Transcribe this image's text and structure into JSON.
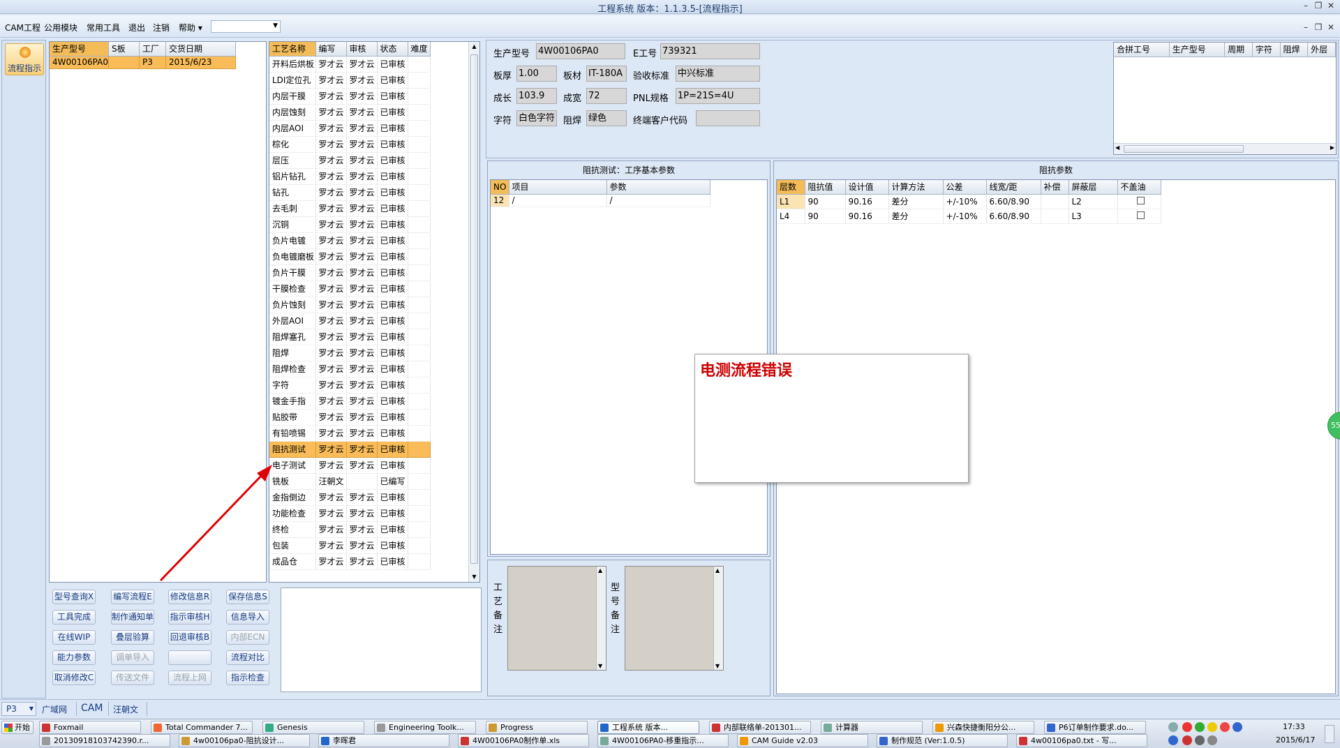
{
  "window": {
    "title": "工程系统 版本：1.1.3.5-[流程指示]"
  },
  "menu": {
    "items": [
      "CAM工程",
      "公用模块",
      "常用工具",
      "退出",
      "注销",
      "帮助 ▾"
    ]
  },
  "side_nav": {
    "label": "流程指示",
    "badge": "55"
  },
  "orders": {
    "columns": [
      "生产型号",
      "S板",
      "工厂",
      "交货日期"
    ],
    "rows": [
      [
        "4W00106PA0",
        "",
        "P3",
        "2015/6/23"
      ]
    ]
  },
  "process": {
    "columns": [
      "工艺名称",
      "编写",
      "审核",
      "状态",
      "难度"
    ],
    "rows": [
      [
        "开料后烘板",
        "罗才云",
        "罗才云",
        "已审核"
      ],
      [
        "LDI定位孔",
        "罗才云",
        "罗才云",
        "已审核"
      ],
      [
        "内层干膜",
        "罗才云",
        "罗才云",
        "已审核"
      ],
      [
        "内层蚀刻",
        "罗才云",
        "罗才云",
        "已审核"
      ],
      [
        "内层AOI",
        "罗才云",
        "罗才云",
        "已审核"
      ],
      [
        "棕化",
        "罗才云",
        "罗才云",
        "已审核"
      ],
      [
        "层压",
        "罗才云",
        "罗才云",
        "已审核"
      ],
      [
        "铝片钻孔",
        "罗才云",
        "罗才云",
        "已审核"
      ],
      [
        "钻孔",
        "罗才云",
        "罗才云",
        "已审核"
      ],
      [
        "去毛刺",
        "罗才云",
        "罗才云",
        "已审核"
      ],
      [
        "沉铜",
        "罗才云",
        "罗才云",
        "已审核"
      ],
      [
        "负片电镀",
        "罗才云",
        "罗才云",
        "已审核"
      ],
      [
        "负电镀磨板",
        "罗才云",
        "罗才云",
        "已审核"
      ],
      [
        "负片干膜",
        "罗才云",
        "罗才云",
        "已审核"
      ],
      [
        "干膜检查",
        "罗才云",
        "罗才云",
        "已审核"
      ],
      [
        "负片蚀刻",
        "罗才云",
        "罗才云",
        "已审核"
      ],
      [
        "外层AOI",
        "罗才云",
        "罗才云",
        "已审核"
      ],
      [
        "阻焊塞孔",
        "罗才云",
        "罗才云",
        "已审核"
      ],
      [
        "阻焊",
        "罗才云",
        "罗才云",
        "已审核"
      ],
      [
        "阻焊检查",
        "罗才云",
        "罗才云",
        "已审核"
      ],
      [
        "字符",
        "罗才云",
        "罗才云",
        "已审核"
      ],
      [
        "镀金手指",
        "罗才云",
        "罗才云",
        "已审核"
      ],
      [
        "贴胶带",
        "罗才云",
        "罗才云",
        "已审核"
      ],
      [
        "有铅喷锡",
        "罗才云",
        "罗才云",
        "已审核"
      ],
      [
        "阻抗测试",
        "罗才云",
        "罗才云",
        "已审核"
      ],
      [
        "电子测试",
        "罗才云",
        "罗才云",
        "已审核"
      ],
      [
        "铣板",
        "汪朝文",
        "",
        "已编写"
      ],
      [
        "金指倒边",
        "罗才云",
        "罗才云",
        "已审核"
      ],
      [
        "功能检查",
        "罗才云",
        "罗才云",
        "已审核"
      ],
      [
        "终检",
        "罗才云",
        "罗才云",
        "已审核"
      ],
      [
        "包装",
        "罗才云",
        "罗才云",
        "已审核"
      ],
      [
        "成品仓",
        "罗才云",
        "罗才云",
        "已审核"
      ]
    ],
    "highlight_index": 24
  },
  "buttons": [
    [
      "型号查询X",
      "编写流程E",
      "修改信息R",
      "保存信息S"
    ],
    [
      "工具完成",
      "制作通知单",
      "指示审核H",
      "信息导入"
    ],
    [
      "在线WIP",
      "叠层验算",
      "回退审核B",
      "内部ECN"
    ],
    [
      "能力参数",
      "调单导入",
      "",
      "流程对比"
    ],
    [
      "取消修改C",
      "传送文件",
      "流程上网",
      "指示检查"
    ]
  ],
  "disabled_buttons": [
    "内部ECN",
    "调单导入",
    "传送文件",
    "流程上网"
  ],
  "info": {
    "prod_model_label": "生产型号",
    "prod_model": "4W00106PA0",
    "e_no_label": "E工号",
    "e_no": "739321",
    "thickness_label": "板厚",
    "thickness": "1.00",
    "material_label": "板材",
    "material": "IT-180A",
    "standard_label": "验收标准",
    "standard": "中兴标准",
    "length_label": "成长",
    "length": "103.9",
    "width_label": "成宽",
    "width": "72",
    "pnl_label": "PNL规格",
    "pnl": "1P=21S=4U",
    "char_label": "字符",
    "char": "白色字符",
    "mask_label": "阻焊",
    "mask": "绿色",
    "customer_code_label": "终端客户代码",
    "customer_code": ""
  },
  "merge_table": {
    "columns": [
      "合拼工号",
      "生产型号",
      "周期",
      "字符",
      "阻焊",
      "外层"
    ]
  },
  "imp_test": {
    "title": "阻抗测试：工序基本参数",
    "columns": [
      "NO",
      "项目",
      "参数"
    ],
    "rows": [
      [
        "12",
        "/",
        "/"
      ]
    ]
  },
  "imp_params": {
    "title": "阻抗参数",
    "columns": [
      "层数",
      "阻抗值",
      "设计值",
      "计算方法",
      "公差",
      "线宽/距",
      "补偿",
      "屏蔽层",
      "不盖油"
    ],
    "rows": [
      [
        "L1",
        "90",
        "90.16",
        "差分",
        "+/-10%",
        "6.60/8.90",
        "",
        "L2"
      ],
      [
        "L4",
        "90",
        "90.16",
        "差分",
        "+/-10%",
        "6.60/8.90",
        "",
        "L3"
      ]
    ]
  },
  "popup": {
    "message": "电测流程错误"
  },
  "remarks": {
    "process_label": "工艺备注",
    "model_label": "型号备注"
  },
  "statusbar": {
    "combo": "P3",
    "tabs": [
      "广域网",
      "CAM",
      "汪朝文"
    ]
  },
  "taskbar": {
    "start": "开始",
    "row1": [
      "Foxmail",
      "Total Commander 7...",
      "Genesis",
      "Engineering Toolk...",
      "Progress",
      "工程系统  版本...",
      "内部联络单-201301...",
      "计算器",
      "兴森快捷衡阳分公...",
      "P6订单制作要求.do..."
    ],
    "row2": [
      "20130918103742390.r...",
      "4w00106pa0-阻抗设计...",
      "李晖君",
      "4W00106PA0制作单.xls",
      "4W00106PA0-移重指示...",
      "CAM Guide v2.03",
      "制作规范 (Ver:1.0.5)",
      "4w00106pa0.txt - 写..."
    ],
    "active": "工程系统  版本...",
    "time": "17:33",
    "date": "2015/6/17"
  },
  "colors": {
    "highlight": "#f9bc58",
    "popup_text": "#cc0000",
    "accent": "#1e3c6e"
  }
}
